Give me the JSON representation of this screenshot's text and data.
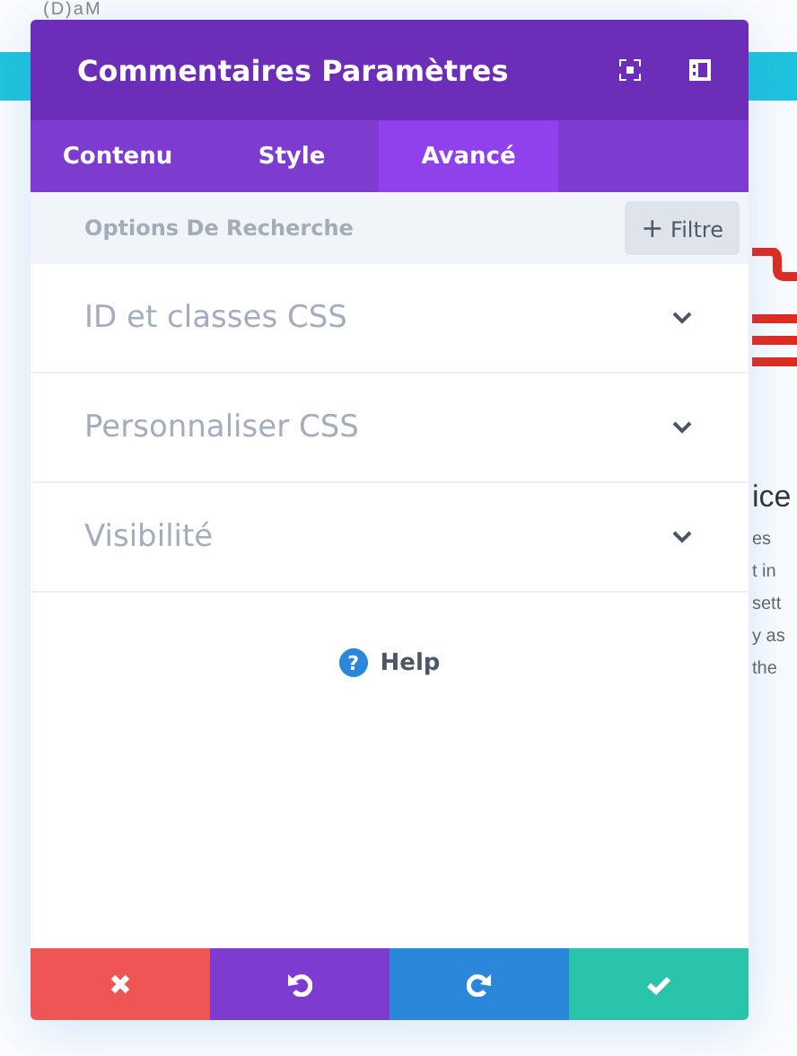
{
  "background": {
    "heading_fragment": "(D)aM",
    "title_fragment": "ice",
    "text_fragments": [
      "es",
      "t in",
      "sett",
      "y as",
      "the"
    ]
  },
  "panel": {
    "title": "Commentaires Paramètres",
    "tabs": [
      {
        "label": "Contenu",
        "selected": false
      },
      {
        "label": "Style",
        "selected": false
      },
      {
        "label": "Avancé",
        "selected": true
      }
    ],
    "search": {
      "placeholder": "Options De Recherche"
    },
    "filter_button": {
      "icon": "+",
      "label": "Filtre"
    },
    "sections": [
      {
        "label": "ID et classes CSS",
        "expanded": false
      },
      {
        "label": "Personnaliser CSS",
        "expanded": false
      },
      {
        "label": "Visibilité",
        "expanded": false
      }
    ],
    "help": {
      "icon": "?",
      "label": "Help"
    },
    "footer_buttons": [
      {
        "kind": "cancel"
      },
      {
        "kind": "undo"
      },
      {
        "kind": "redo"
      },
      {
        "kind": "save"
      }
    ]
  }
}
